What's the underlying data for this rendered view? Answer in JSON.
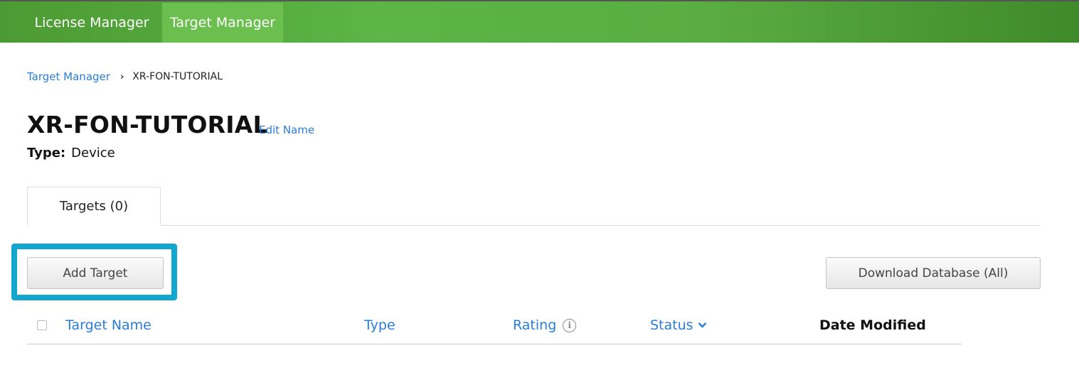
{
  "nav": {
    "items": [
      {
        "label": "License Manager"
      },
      {
        "label": "Target Manager"
      }
    ]
  },
  "breadcrumb": {
    "root": "Target Manager",
    "separator": "›",
    "current": "XR-FON-TUTORIAL"
  },
  "page": {
    "title": "XR-FON-TUTORIAL",
    "edit_label": "Edit Name",
    "type_label": "Type:",
    "type_value": "Device"
  },
  "tabs": [
    {
      "label": "Targets (0)"
    }
  ],
  "actions": {
    "add_label": "Add Target",
    "download_label": "Download Database (All)"
  },
  "table": {
    "columns": [
      "Target Name",
      "Type",
      "Rating",
      "Status",
      "Date Modified"
    ],
    "rows": []
  },
  "icons": {
    "rating_info": "info-icon",
    "status_sort": "chevron-down-icon"
  },
  "colors": {
    "brand_green": "#5cb546",
    "active_nav": "#6abf4f",
    "link": "#2a7dd6",
    "highlight": "#13a6cf"
  }
}
